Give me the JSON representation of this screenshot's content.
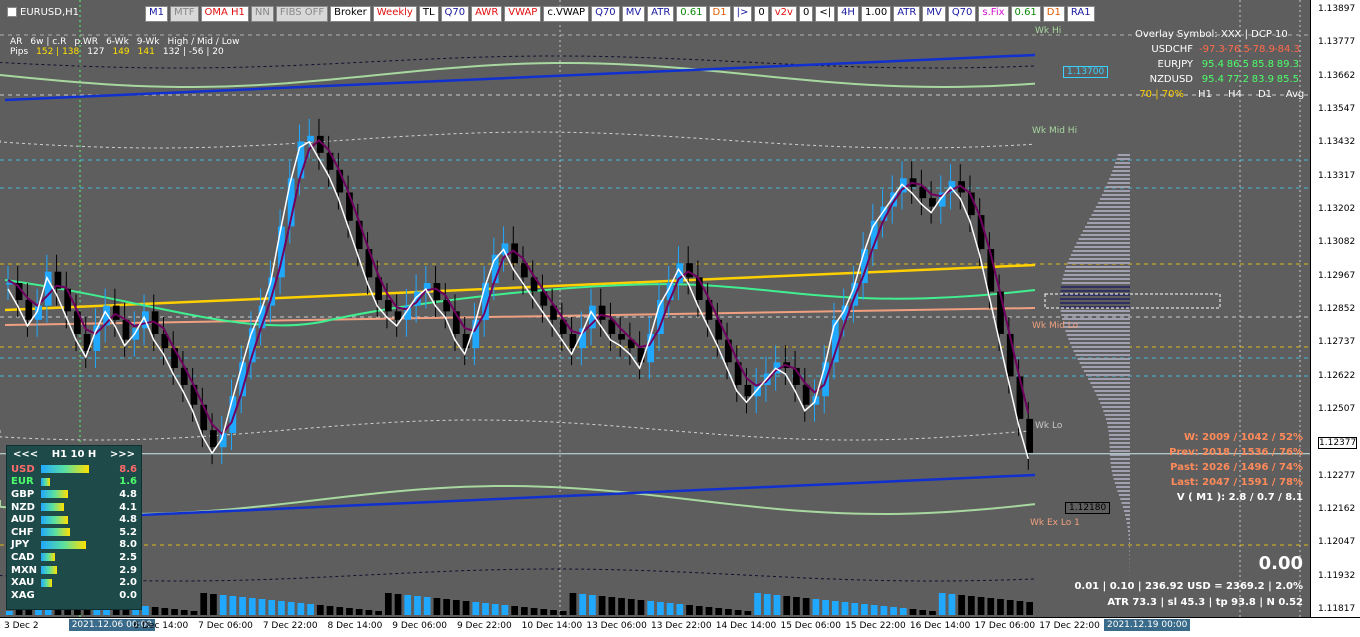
{
  "symbol": "EURUSD,H1",
  "toolbar": [
    "M1",
    "MTF",
    "OMA H1",
    "NN",
    "FIBS OFF",
    "Broker",
    "Weekly",
    "TL",
    "Q70",
    "AWR",
    "VWAP",
    "c.VWAP",
    "Q70",
    "MV",
    "ATR",
    "0.61",
    "D1",
    "|>",
    "0",
    "v2v",
    "0",
    "<|",
    "4H",
    "1.00",
    "ATR",
    "MV",
    "Q70",
    "s.Fix",
    "0.61",
    "D1",
    "RA1"
  ],
  "stats": {
    "headers": [
      "AR",
      "6w | c.R",
      "p.WR",
      "6-Wk",
      "9-Wk",
      "High / Mid / Low"
    ],
    "row_label": "Pips",
    "values": [
      "152 | 138",
      "127",
      "149",
      "141",
      "132 | -56 | 20"
    ]
  },
  "overlay": {
    "title": "Overlay Symbol: XXX | DCP 10",
    "rows": [
      {
        "sym": "USDCHF",
        "vals": [
          "-97.3",
          "-76.5",
          "-78.9",
          "-84.3"
        ],
        "neg": true
      },
      {
        "sym": "EURJPY",
        "vals": [
          "95.4",
          "86.5",
          "85.8",
          "89.3"
        ],
        "neg": false
      },
      {
        "sym": "NZDUSD",
        "vals": [
          "95.4",
          "77.2",
          "83.9",
          "85.5"
        ],
        "neg": false
      }
    ],
    "footer_left": "70 | 70%",
    "footer_cols": [
      "H1",
      "H4",
      "D1",
      "Avg"
    ]
  },
  "strength": {
    "nav_prev": "<<<",
    "title": "H1  10  H",
    "nav_next": ">>>",
    "rows": [
      {
        "cur": "USD",
        "val": "8.6",
        "pct": 0.86,
        "color": "#ff6a6a"
      },
      {
        "cur": "EUR",
        "val": "1.6",
        "pct": 0.16,
        "color": "#4cff6a"
      },
      {
        "cur": "GBP",
        "val": "4.8",
        "pct": 0.48,
        "color": "#ffffff"
      },
      {
        "cur": "NZD",
        "val": "4.1",
        "pct": 0.41,
        "color": "#ffffff"
      },
      {
        "cur": "AUD",
        "val": "4.8",
        "pct": 0.48,
        "color": "#ffffff"
      },
      {
        "cur": "CHF",
        "val": "5.2",
        "pct": 0.52,
        "color": "#ffffff"
      },
      {
        "cur": "JPY",
        "val": "8.0",
        "pct": 0.8,
        "color": "#ffffff"
      },
      {
        "cur": "CAD",
        "val": "2.5",
        "pct": 0.25,
        "color": "#ffffff"
      },
      {
        "cur": "MXN",
        "val": "2.9",
        "pct": 0.29,
        "color": "#ffffff"
      },
      {
        "cur": "XAU",
        "val": "2.0",
        "pct": 0.2,
        "color": "#ffffff"
      },
      {
        "cur": "XAG",
        "val": "0.0",
        "pct": 0.0,
        "color": "#ffffff"
      }
    ]
  },
  "weekly_stats": [
    {
      "text": "W: 2009 / 1042 / 52%",
      "color": "#ff8a5a"
    },
    {
      "text": "Prev: 2018 / 1536 / 76%",
      "color": "#ff8a5a"
    },
    {
      "text": "Past: 2026 / 1496 / 74%",
      "color": "#ff8a5a"
    },
    {
      "text": "Last: 2047 / 1591 / 78%",
      "color": "#ff8a5a"
    },
    {
      "text": "V ( M1 ): 2.8 / 0.7 / 8.1",
      "color": "#ffffff"
    }
  ],
  "big_value": "0.00",
  "footer_line1": "0.01  |  0.10  |  236.92 USD = 2369.2  |  2.0%",
  "footer_line2": "ATR 73.3  | sl 45.3  |  tp 93.8  |  N 0.52",
  "levels": {
    "wk_hi": "Wk Hi",
    "wk_mid_hi": "Wk Mid Hi",
    "wk_mid_lo": "Wk Mid Lo",
    "wk_lo": "Wk Lo",
    "wk_ex_lo": "Wk Ex Lo 1",
    "box_top": "1.13700",
    "box_bottom": "1.12180",
    "current_price": "1.12377"
  },
  "price_axis": [
    "1.13897",
    "1.13777",
    "1.13662",
    "1.13547",
    "1.13432",
    "1.13317",
    "1.13202",
    "1.13082",
    "1.12967",
    "1.12852",
    "1.12737",
    "1.12622",
    "1.12507",
    "1.12377",
    "1.12277",
    "1.12162",
    "1.12047",
    "1.11932",
    "1.11817"
  ],
  "time_axis": [
    "3 Dec 2",
    "2021.12.06 00:00",
    "6 Dec 14:00",
    "7 Dec 06:00",
    "7 Dec 22:00",
    "8 Dec 14:00",
    "9 Dec 06:00",
    "9 Dec 22:00",
    "10 Dec 14:00",
    "13 Dec 06:00",
    "13 Dec 22:00",
    "14 Dec 14:00",
    "15 Dec 06:00",
    "15 Dec 22:00",
    "16 Dec 14:00",
    "17 Dec 06:00",
    "17 Dec 22:00",
    "2021.12.19 00:00"
  ],
  "chart_data": {
    "type": "candlestick",
    "price_range": [
      1.118,
      1.1392
    ],
    "closes": [
      1.1298,
      1.1292,
      1.1285,
      1.129,
      1.1302,
      1.1296,
      1.1288,
      1.128,
      1.1274,
      1.1283,
      1.129,
      1.1285,
      1.1278,
      1.1282,
      1.1288,
      1.128,
      1.1275,
      1.1268,
      1.1262,
      1.1255,
      1.1246,
      1.124,
      1.1245,
      1.1258,
      1.127,
      1.1282,
      1.129,
      1.13,
      1.1318,
      1.1335,
      1.1348,
      1.135,
      1.1344,
      1.1338,
      1.133,
      1.132,
      1.131,
      1.13,
      1.1292,
      1.1288,
      1.1285,
      1.129,
      1.1295,
      1.1298,
      1.1292,
      1.1288,
      1.128,
      1.1275,
      1.1285,
      1.1298,
      1.1308,
      1.1312,
      1.1305,
      1.13,
      1.1295,
      1.129,
      1.1285,
      1.128,
      1.1275,
      1.1282,
      1.129,
      1.1285,
      1.128,
      1.1278,
      1.1275,
      1.127,
      1.128,
      1.1292,
      1.1298,
      1.1305,
      1.13,
      1.1292,
      1.1285,
      1.1278,
      1.127,
      1.1262,
      1.1258,
      1.1262,
      1.1266,
      1.127,
      1.1268,
      1.1262,
      1.1255,
      1.1258,
      1.127,
      1.1285,
      1.129,
      1.1298,
      1.131,
      1.132,
      1.1325,
      1.133,
      1.1335,
      1.1332,
      1.1328,
      1.1325,
      1.133,
      1.1334,
      1.133,
      1.1322,
      1.131,
      1.1295,
      1.128,
      1.1265,
      1.125,
      1.1238
    ]
  }
}
